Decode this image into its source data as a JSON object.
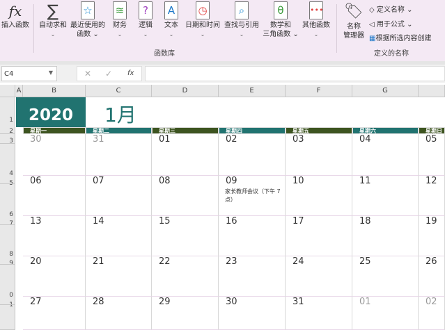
{
  "ribbon": {
    "buttons": [
      {
        "label": "插入函数",
        "icon": "fx-icon"
      },
      {
        "label": "自动求和",
        "icon": "sigma-icon"
      },
      {
        "label": "最近使用的",
        "label2": "函数",
        "icon": "star-book-icon"
      },
      {
        "label": "财务",
        "icon": "database-book-icon"
      },
      {
        "label": "逻辑",
        "icon": "question-book-icon"
      },
      {
        "label": "文本",
        "icon": "text-book-icon"
      },
      {
        "label": "日期和时间",
        "icon": "clock-book-icon"
      },
      {
        "label": "查找与引用",
        "icon": "search-book-icon"
      },
      {
        "label": "数学和",
        "label2": "三角函数",
        "icon": "theta-book-icon"
      },
      {
        "label": "其他函数",
        "icon": "more-book-icon"
      }
    ],
    "group1": "函数库",
    "name_manager": {
      "label": "名称",
      "label2": "管理器"
    },
    "define_name": "定义名称",
    "use_in_formula": "用于公式",
    "create_from_selection": "根据所选内容创建",
    "group2": "定义的名称"
  },
  "formula_bar": {
    "name_box": "C4",
    "fx": "fx",
    "cancel": "✕",
    "enter": "✓",
    "value": ""
  },
  "columns": [
    "A",
    "B",
    "C",
    "D",
    "E",
    "F",
    "G"
  ],
  "rows": [
    "1",
    "2",
    "3",
    "4",
    "5",
    "6",
    "7",
    "8",
    "9",
    "0",
    "1"
  ],
  "calendar": {
    "year": "2020",
    "month": "1月",
    "days": [
      "星期一",
      "星期二",
      "星期三",
      "星期四",
      "星期五",
      "星期六",
      "星期日"
    ],
    "colors": {
      "teal": "#217370",
      "olive": "#3d5420"
    },
    "weeks": [
      [
        "30",
        "31",
        "01",
        "02",
        "03",
        "04",
        "05"
      ],
      [
        "06",
        "07",
        "08",
        "09",
        "10",
        "11",
        "12"
      ],
      [
        "13",
        "14",
        "15",
        "16",
        "17",
        "18",
        "19"
      ],
      [
        "20",
        "21",
        "22",
        "23",
        "24",
        "25",
        "26"
      ],
      [
        "27",
        "28",
        "29",
        "30",
        "31",
        "01",
        "02"
      ]
    ],
    "note": "家长教师会议（下午 7 点）"
  }
}
